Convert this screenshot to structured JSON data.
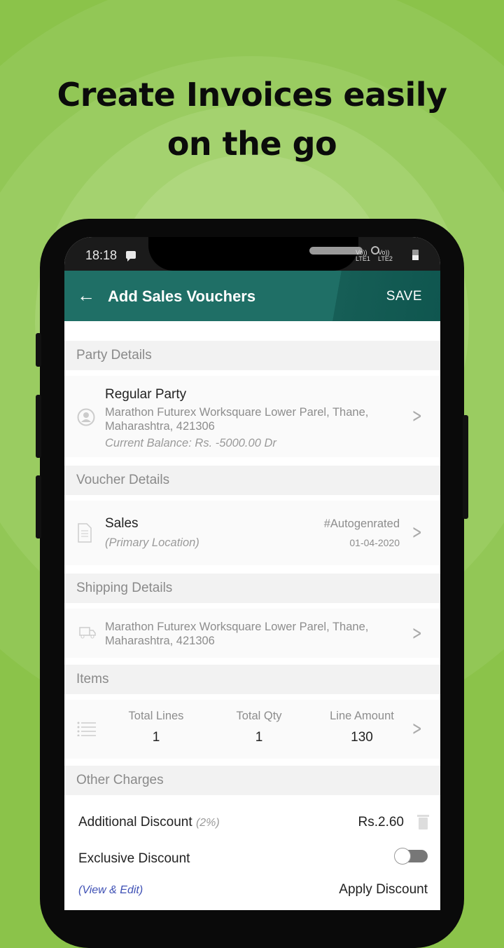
{
  "headline": {
    "line1": "Create Invoices easily",
    "line2": "on the go"
  },
  "status_bar": {
    "time": "18:18",
    "sim1": "LTE1",
    "sim2": "LTE2",
    "volte1": "Vo))",
    "volte2": "Vo))"
  },
  "app_bar": {
    "title": "Add Sales Vouchers",
    "save_label": "SAVE",
    "back_icon": "arrow-left-icon"
  },
  "sections": {
    "party": {
      "header": "Party Details",
      "name": "Regular Party",
      "address_line1": "Marathon Futurex Worksquare Lower Parel, Thane,",
      "address_line2": "Maharashtra, 421306",
      "balance": "Current Balance: Rs. -5000.00 Dr"
    },
    "voucher": {
      "header": "Voucher Details",
      "type": "Sales",
      "location": "(Primary Location)",
      "number": "#Autogenrated",
      "date": "01-04-2020"
    },
    "shipping": {
      "header": "Shipping Details",
      "address_line1": "Marathon Futurex Worksquare Lower Parel, Thane,",
      "address_line2": "Maharashtra, 421306"
    },
    "items": {
      "header": "Items",
      "stats": [
        {
          "label": "Total Lines",
          "value": "1"
        },
        {
          "label": "Total Qty",
          "value": "1"
        },
        {
          "label": "Line Amount",
          "value": "130"
        }
      ]
    },
    "other_charges": {
      "header": "Other Charges",
      "additional_discount_label": "Additional Discount",
      "additional_discount_pct": "(2%)",
      "additional_discount_amount": "Rs.2.60",
      "exclusive_discount_label": "Exclusive Discount",
      "exclusive_discount_on": false,
      "view_edit_link": "(View & Edit)",
      "apply_discount_label": "Apply Discount"
    }
  },
  "colors": {
    "background": "#8bc34a",
    "app_bar": "#1f6f66",
    "link": "#3f51b5"
  }
}
